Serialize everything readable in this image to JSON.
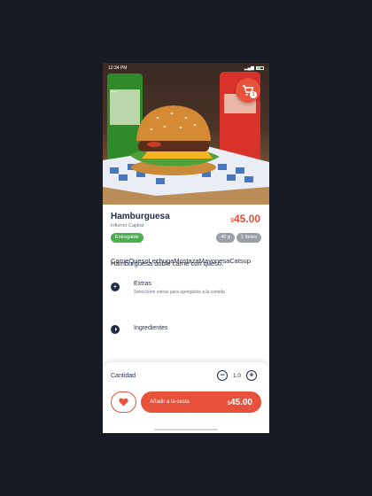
{
  "status_bar": {
    "time": "12:34 PM"
  },
  "hero": {
    "cart_badge": "1"
  },
  "product": {
    "name": "Hamburguesa",
    "restaurant": "Infierno Capital",
    "price_currency": "$",
    "price_amount": "45.00",
    "availability_tag": "Entregable",
    "chips": [
      "40 g",
      "1 Items"
    ],
    "description": "Hamburguesa doble carne con queso."
  },
  "extras": {
    "title": "Extras",
    "subtitle": "Seleccione extras para agregarlos a la comida"
  },
  "ingredients": {
    "title": "Ingredientes",
    "list": "CarneQuesoLechugaMostazaMayonesaCatsup"
  },
  "quantity": {
    "label": "Cantidad",
    "value": "1.0"
  },
  "actions": {
    "add_label": "Añadir a la cesta",
    "total_currency": "$",
    "total_amount": "45.00"
  },
  "colors": {
    "accent": "#e8513b",
    "green": "#4caf50",
    "text": "#1f2a44"
  }
}
